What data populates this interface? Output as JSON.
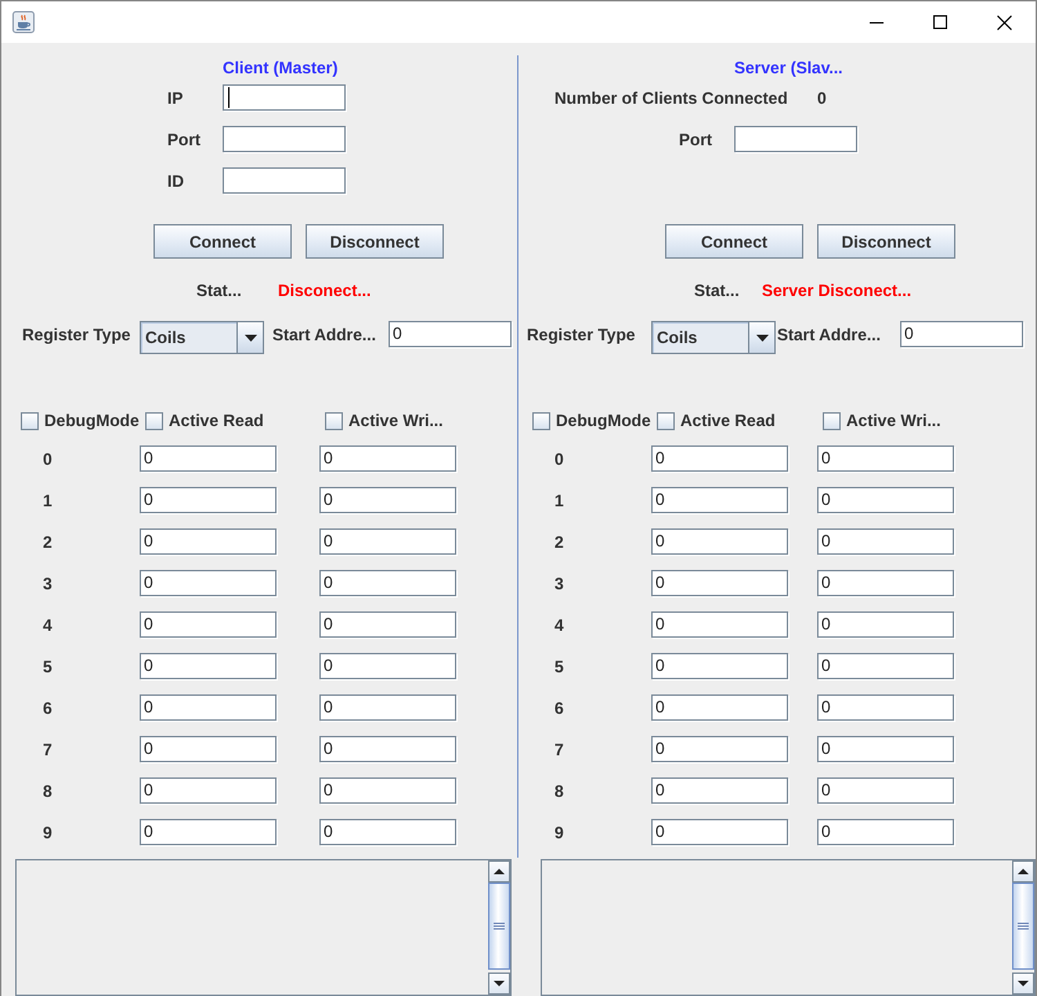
{
  "panels": [
    {
      "kind": "client",
      "heading": "Client (Master)",
      "header_rows": [
        {
          "kind": "field",
          "label": "IP",
          "focused": true
        },
        {
          "kind": "field",
          "label": "Port",
          "focused": false
        },
        {
          "kind": "field",
          "label": "ID",
          "focused": false
        }
      ],
      "buttons": [
        "Connect",
        "Disconnect"
      ],
      "status": {
        "label": "Stat...",
        "value": "Disconect...",
        "connected": false
      },
      "register_type": {
        "label": "Register Type",
        "value": "Coils"
      },
      "start_address": {
        "label": "Start Addre...",
        "value": "0"
      },
      "checkboxes": [
        {
          "label": "DebugMode",
          "checked": false
        },
        {
          "label": "Active Read",
          "checked": false
        },
        {
          "label": "Active Wri...",
          "checked": false
        }
      ],
      "registers": [
        {
          "label": "0",
          "read": "0",
          "write": "0"
        },
        {
          "label": "1",
          "read": "0",
          "write": "0"
        },
        {
          "label": "2",
          "read": "0",
          "write": "0"
        },
        {
          "label": "3",
          "read": "0",
          "write": "0"
        },
        {
          "label": "4",
          "read": "0",
          "write": "0"
        },
        {
          "label": "5",
          "read": "0",
          "write": "0"
        },
        {
          "label": "6",
          "read": "0",
          "write": "0"
        },
        {
          "label": "7",
          "read": "0",
          "write": "0"
        },
        {
          "label": "8",
          "read": "0",
          "write": "0"
        },
        {
          "label": "9",
          "read": "0",
          "write": "0"
        }
      ]
    },
    {
      "kind": "server",
      "heading": "Server (Slav...",
      "header_rows": [
        {
          "kind": "reading",
          "label": "Number of Clients Connected",
          "value": "0"
        },
        {
          "kind": "field",
          "label": "Port",
          "focused": false
        }
      ],
      "buttons": [
        "Connect",
        "Disconnect"
      ],
      "status": {
        "label": "Stat...",
        "value": "Server Disconect...",
        "connected": false
      },
      "register_type": {
        "label": "Register Type",
        "value": "Coils"
      },
      "start_address": {
        "label": "Start Addre...",
        "value": "0"
      },
      "checkboxes": [
        {
          "label": "DebugMode",
          "checked": false
        },
        {
          "label": "Active Read",
          "checked": false
        },
        {
          "label": "Active Wri...",
          "checked": false
        }
      ],
      "registers": [
        {
          "label": "0",
          "read": "0",
          "write": "0"
        },
        {
          "label": "1",
          "read": "0",
          "write": "0"
        },
        {
          "label": "2",
          "read": "0",
          "write": "0"
        },
        {
          "label": "3",
          "read": "0",
          "write": "0"
        },
        {
          "label": "4",
          "read": "0",
          "write": "0"
        },
        {
          "label": "5",
          "read": "0",
          "write": "0"
        },
        {
          "label": "6",
          "read": "0",
          "write": "0"
        },
        {
          "label": "7",
          "read": "0",
          "write": "0"
        },
        {
          "label": "8",
          "read": "0",
          "write": "0"
        },
        {
          "label": "9",
          "read": "0",
          "write": "0"
        }
      ]
    }
  ]
}
